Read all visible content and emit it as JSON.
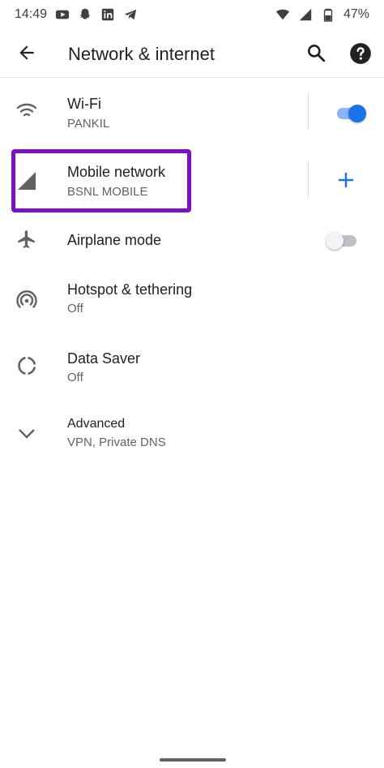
{
  "status_bar": {
    "time": "14:49",
    "battery": "47%",
    "left_icons": [
      "youtube-icon",
      "snapchat-icon",
      "linkedin-icon",
      "telegram-icon"
    ],
    "right_icons": [
      "wifi-status-icon",
      "signal-icon",
      "battery-icon"
    ]
  },
  "app_bar": {
    "title": "Network & internet",
    "icons": [
      "back-arrow-icon",
      "search-icon",
      "help-icon"
    ]
  },
  "settings": {
    "wifi": {
      "title": "Wi-Fi",
      "summary": "PANKIL",
      "toggle_on": true
    },
    "mobile_network": {
      "title": "Mobile network",
      "summary": "BSNL MOBILE",
      "action_icon": "plus-icon",
      "highlighted": true
    },
    "airplane_mode": {
      "title": "Airplane mode",
      "toggle_on": false
    },
    "hotspot": {
      "title": "Hotspot & tethering",
      "summary": "Off"
    },
    "data_saver": {
      "title": "Data Saver",
      "summary": "Off"
    },
    "advanced": {
      "title": "Advanced",
      "summary": "VPN, Private DNS"
    }
  },
  "colors": {
    "accent": "#1a73e8",
    "highlight_border": "#7a10c9",
    "icon_gray": "#5f6368",
    "divider": "#dadce0"
  }
}
